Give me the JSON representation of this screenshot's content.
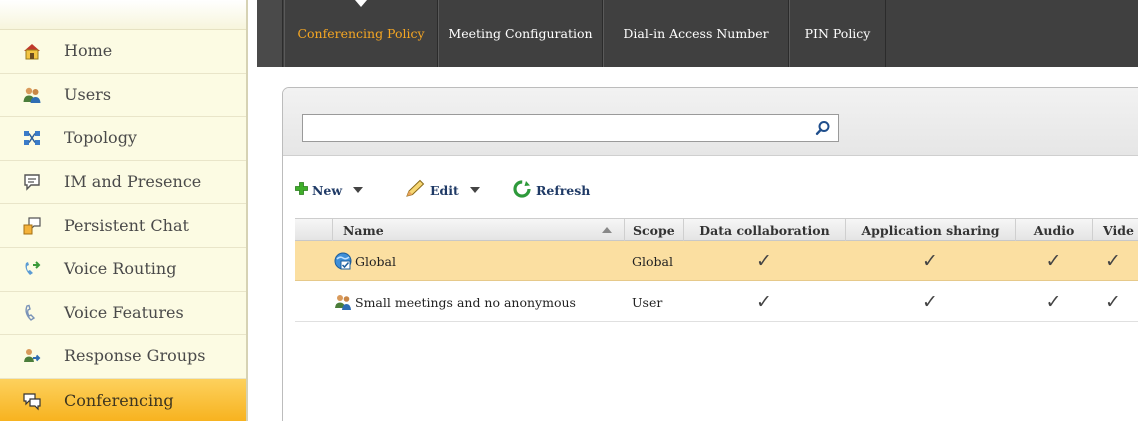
{
  "sidebar": {
    "items": [
      {
        "label": "Home",
        "icon": "home-icon",
        "active": false
      },
      {
        "label": "Users",
        "icon": "users-icon",
        "active": false
      },
      {
        "label": "Topology",
        "icon": "topology-icon",
        "active": false
      },
      {
        "label": "IM and Presence",
        "icon": "im-presence-icon",
        "active": false
      },
      {
        "label": "Persistent Chat",
        "icon": "persistent-chat-icon",
        "active": false
      },
      {
        "label": "Voice Routing",
        "icon": "voice-routing-icon",
        "active": false
      },
      {
        "label": "Voice Features",
        "icon": "voice-features-icon",
        "active": false
      },
      {
        "label": "Response Groups",
        "icon": "response-groups-icon",
        "active": false
      },
      {
        "label": "Conferencing",
        "icon": "conferencing-icon",
        "active": true
      }
    ]
  },
  "tabs": [
    {
      "label": "Conferencing Policy",
      "active": true
    },
    {
      "label": "Meeting Configuration",
      "active": false
    },
    {
      "label": "Dial-in Access Number",
      "active": false
    },
    {
      "label": "PIN Policy",
      "active": false
    }
  ],
  "search": {
    "value": "",
    "placeholder": ""
  },
  "toolbar": {
    "new_label": "New",
    "edit_label": "Edit",
    "refresh_label": "Refresh"
  },
  "table": {
    "columns": [
      "Name",
      "Scope",
      "Data collaboration",
      "Application sharing",
      "Audio",
      "Vide"
    ],
    "rows": [
      {
        "name": "Global",
        "scope": "Global",
        "icon": "global-policy-icon",
        "selected": true,
        "data_collaboration": "✓",
        "application_sharing": "✓",
        "audio": "✓",
        "video": "✓"
      },
      {
        "name": "Small meetings and no anonymous",
        "scope": "User",
        "icon": "user-policy-icon",
        "selected": false,
        "data_collaboration": "✓",
        "application_sharing": "✓",
        "audio": "✓",
        "video": "✓"
      }
    ]
  },
  "colors": {
    "sidebar_bg": "#fcfbe3",
    "active_nav": "#f7b21e",
    "tabbar_bg": "#404040",
    "active_tab_text": "#f5a623",
    "selected_row": "#fbdfa1",
    "toolbar_text": "#1f3a66"
  }
}
